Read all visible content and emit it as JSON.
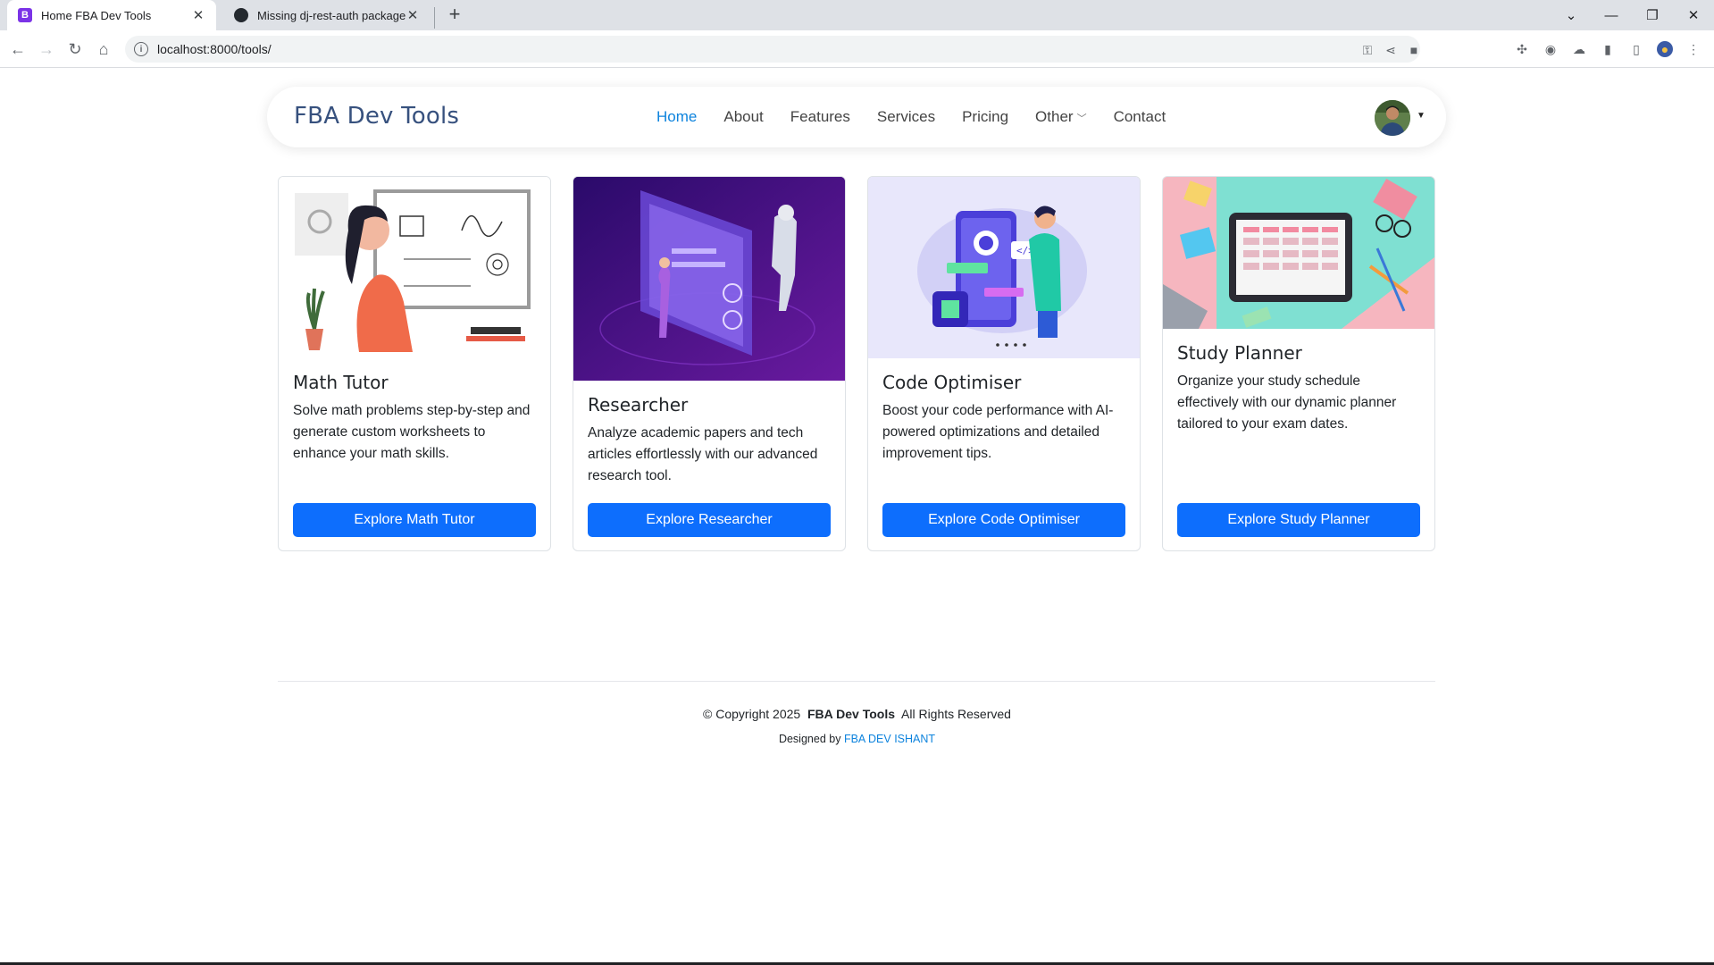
{
  "browser": {
    "tabs": [
      {
        "title": "Home FBA Dev Tools",
        "favicon": "B"
      },
      {
        "title": "Missing dj-rest-auth package",
        "favicon": "github-icon"
      }
    ],
    "url": "localhost:8000/tools/"
  },
  "site": {
    "brand": "FBA Dev Tools",
    "menu": [
      "Home",
      "About",
      "Features",
      "Services",
      "Pricing",
      "Other",
      "Contact"
    ],
    "active_menu": "Home",
    "accent_color": "#0d83dd",
    "button_color": "#0d6efd"
  },
  "cards": [
    {
      "title": "Math Tutor",
      "text": "Solve math problems step-by-step and generate custom worksheets to enhance your math skills.",
      "button": "Explore Math Tutor"
    },
    {
      "title": "Researcher",
      "text": "Analyze academic papers and tech articles effortlessly with our advanced research tool.",
      "button": "Explore Researcher"
    },
    {
      "title": "Code Optimiser",
      "text": "Boost your code performance with AI-powered optimizations and detailed improvement tips.",
      "button": "Explore Code Optimiser"
    },
    {
      "title": "Study Planner",
      "text": "Organize your study schedule effectively with our dynamic planner tailored to your exam dates.",
      "button": "Explore Study Planner"
    }
  ],
  "footer": {
    "copyright_prefix": "© Copyright 2025",
    "brand": "FBA Dev Tools",
    "rights": "All Rights Reserved",
    "designed_by": "Designed by",
    "designer": "FBA DEV ISHANT"
  }
}
